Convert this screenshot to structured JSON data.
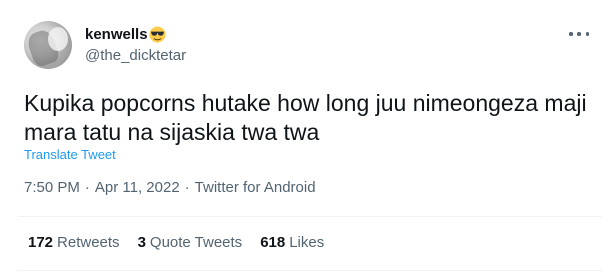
{
  "author": {
    "display_name": "kenwells",
    "handle": "@the_dicktetar",
    "avatar_icon": "avatar-photo",
    "name_emoji": "smiling-face-with-sunglasses"
  },
  "tweet": {
    "text": "Kupika popcorns hutake how long juu nimeongeza maji mara tatu na sijaskia twa twa",
    "translate_label": "Translate Tweet",
    "time": "7:50 PM",
    "date": "Apr 11, 2022",
    "separator": "·",
    "source": "Twitter for Android"
  },
  "stats": {
    "retweets": {
      "count": "172",
      "label": "Retweets"
    },
    "quotes": {
      "count": "3",
      "label": "Quote Tweets"
    },
    "likes": {
      "count": "618",
      "label": "Likes"
    }
  },
  "colors": {
    "text": "#0f1419",
    "secondary": "#536471",
    "link": "#1d9bf0",
    "divider": "#eff3f4"
  },
  "icons": {
    "more": "more-options-icon"
  }
}
